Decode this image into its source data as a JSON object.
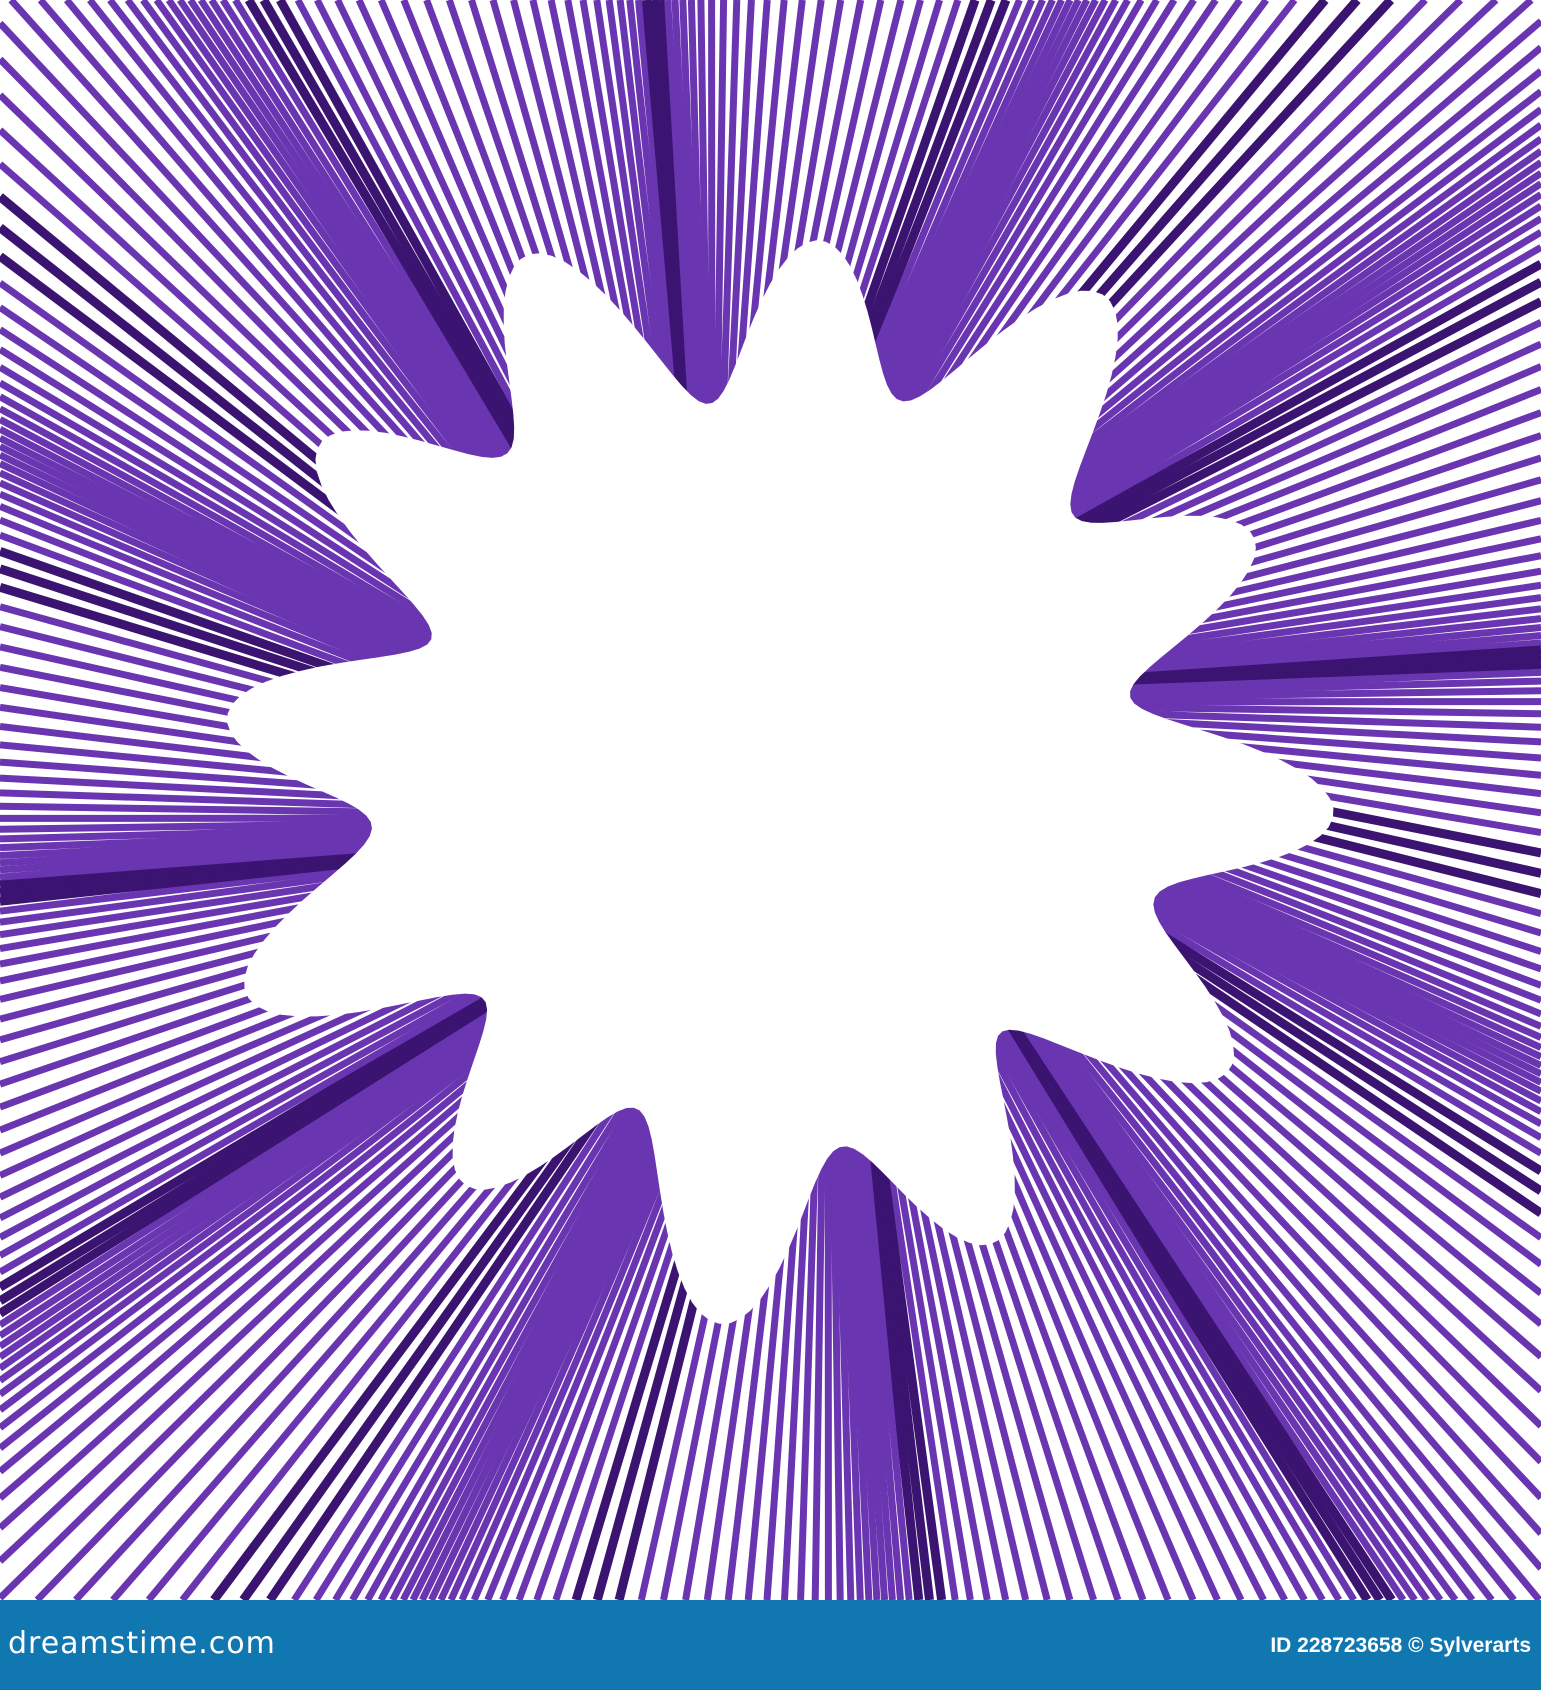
{
  "footer": {
    "logo": "dreamstime.com",
    "credit": "ID 228723658 © Sylverarts"
  },
  "colors": {
    "stripe": "#6a35b0",
    "stripe_dark": "#3a1470",
    "footer_bg": "#1077b0"
  }
}
